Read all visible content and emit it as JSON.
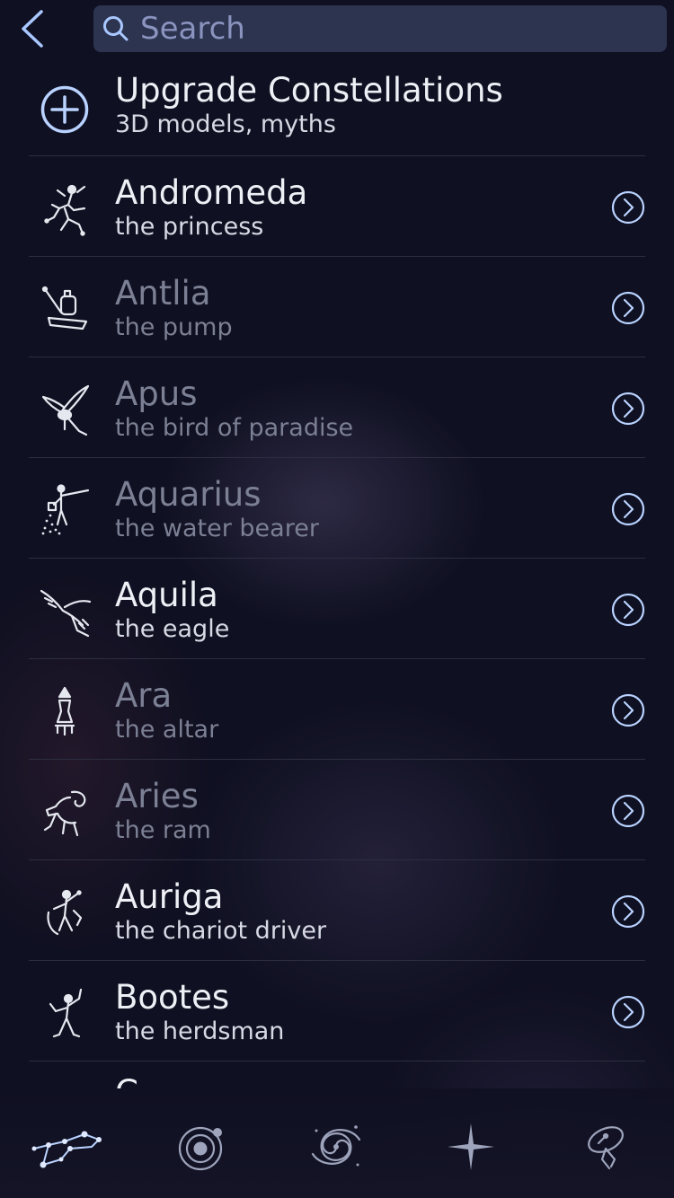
{
  "header": {
    "back_icon": "chevron-left-icon",
    "search": {
      "placeholder": "Search",
      "value": ""
    }
  },
  "upgrade": {
    "title": "Upgrade Constellations",
    "subtitle": "3D models, myths",
    "icon": "plus-circle-icon"
  },
  "constellations": [
    {
      "name": "Andromeda",
      "desc": "the princess",
      "icon": "andromeda-icon",
      "dim": false
    },
    {
      "name": "Antlia",
      "desc": "the pump",
      "icon": "antlia-icon",
      "dim": true
    },
    {
      "name": "Apus",
      "desc": "the bird of paradise",
      "icon": "apus-icon",
      "dim": true
    },
    {
      "name": "Aquarius",
      "desc": "the water bearer",
      "icon": "aquarius-icon",
      "dim": true
    },
    {
      "name": "Aquila",
      "desc": "the eagle",
      "icon": "aquila-icon",
      "dim": false
    },
    {
      "name": "Ara",
      "desc": "the altar",
      "icon": "ara-icon",
      "dim": true
    },
    {
      "name": "Aries",
      "desc": "the ram",
      "icon": "aries-icon",
      "dim": true
    },
    {
      "name": "Auriga",
      "desc": "the chariot driver",
      "icon": "auriga-icon",
      "dim": false
    },
    {
      "name": "Bootes",
      "desc": "the herdsman",
      "icon": "bootes-icon",
      "dim": false
    }
  ],
  "partial_row": {
    "name": "C…",
    "icon": "constellation-icon"
  },
  "tabbar": [
    {
      "name": "constellations",
      "icon": "constellation-icon",
      "active": true
    },
    {
      "name": "planets",
      "icon": "planet-orbit-icon",
      "active": false
    },
    {
      "name": "deep-sky",
      "icon": "galaxy-icon",
      "active": false
    },
    {
      "name": "stars",
      "icon": "star-icon",
      "active": false
    },
    {
      "name": "satellites",
      "icon": "satellite-icon",
      "active": false
    }
  ],
  "colors": {
    "background": "#0f1021",
    "search_field": "#2d3450",
    "accent": "#b9d2ff",
    "separator": "#2c2e40",
    "dim_text": "#7c8094"
  }
}
